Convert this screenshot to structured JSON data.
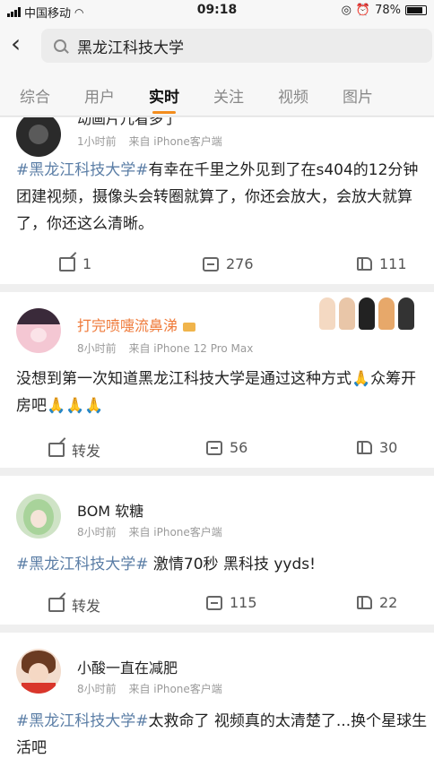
{
  "status_bar": {
    "carrier": "中国移动",
    "time": "09:18",
    "battery": "78%"
  },
  "search": {
    "query": "黑龙江科技大学"
  },
  "tabs": [
    {
      "label": "综合"
    },
    {
      "label": "用户"
    },
    {
      "label": "实时"
    },
    {
      "label": "关注"
    },
    {
      "label": "视频"
    },
    {
      "label": "图片"
    }
  ],
  "posts": [
    {
      "username": "动画片儿看多了",
      "time": "1小时前",
      "source": "来自 iPhone客户端",
      "topic": "#黑龙江科技大学#",
      "body": "有幸在千里之外见到了在s404的12分钟团建视频，摄像头会转圈就算了，你还会放大，会放大就算了，你还这么清晰。",
      "forward": "1",
      "comments": "276",
      "likes": "111"
    },
    {
      "username": "打完喷嚏流鼻涕",
      "time": "8小时前",
      "source": "来自 iPhone 12 Pro Max",
      "topic": "",
      "body": "没想到第一次知道黑龙江科技大学是通过这种方式🙏众筹开房吧🙏🙏🙏",
      "forward": "转发",
      "comments": "56",
      "likes": "30"
    },
    {
      "username": "BOM 软糖",
      "time": "8小时前",
      "source": "来自 iPhone客户端",
      "topic": "#黑龙江科技大学#",
      "body": " 激情70秒 黑科技 yyds!",
      "forward": "转发",
      "comments": "115",
      "likes": "22"
    },
    {
      "username": "小酸一直在减肥",
      "time": "8小时前",
      "source": "来自 iPhone客户端",
      "topic": "#黑龙江科技大学#",
      "body": "太救命了 视频真的太清楚了...换个星球生活吧"
    }
  ],
  "colors": {
    "accent": "#f38d1d",
    "topic": "#5b7ea6",
    "vip": "#f0b44b"
  }
}
